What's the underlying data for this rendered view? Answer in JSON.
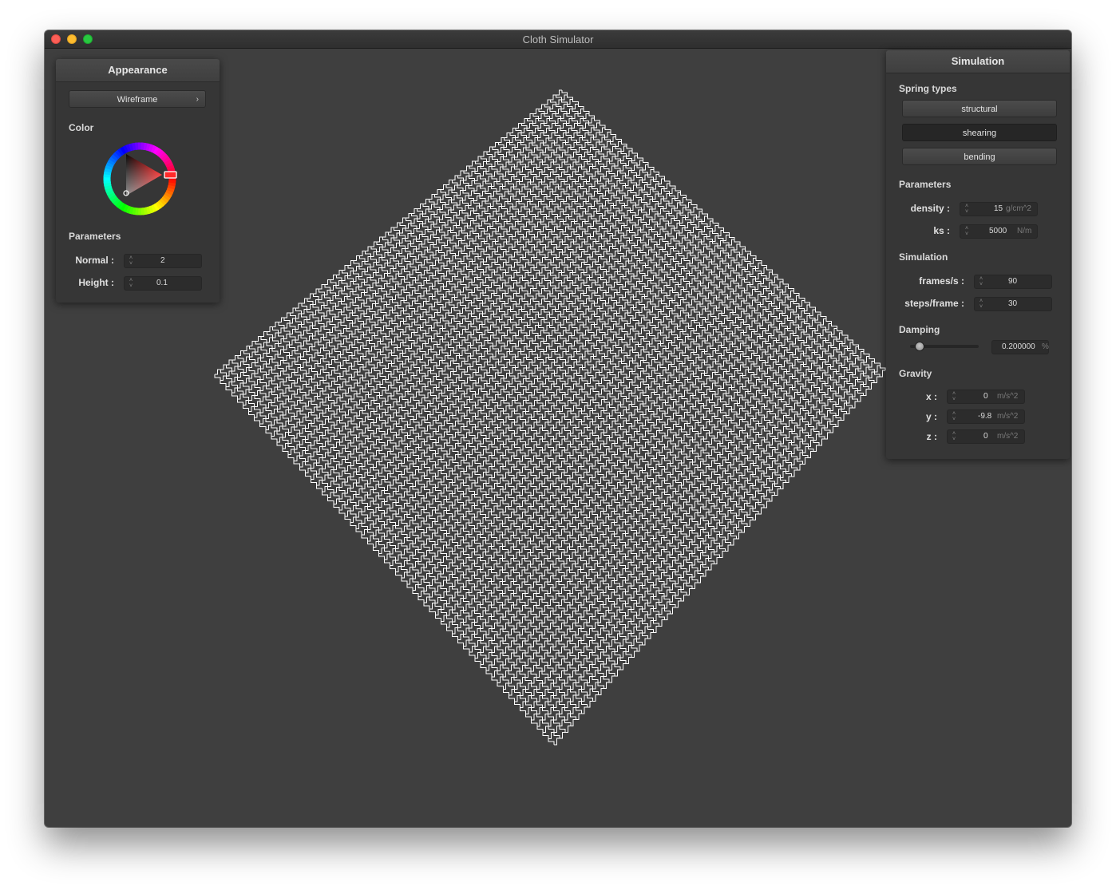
{
  "window": {
    "title": "Cloth Simulator"
  },
  "appearance": {
    "header": "Appearance",
    "shader_select": "Wireframe",
    "shader_chevron": "›",
    "color_label": "Color",
    "parameters_label": "Parameters",
    "normal_label": "Normal :",
    "normal_value": "2",
    "height_label": "Height :",
    "height_value": "0.1",
    "selected_color": "#ff0000"
  },
  "simulation": {
    "header": "Simulation",
    "spring_types_label": "Spring types",
    "spring_buttons": [
      "structural",
      "shearing",
      "bending"
    ],
    "parameters_label": "Parameters",
    "density_label": "density :",
    "density_value": "15",
    "density_unit": "g/cm^2",
    "ks_label": "ks :",
    "ks_value": "5000",
    "ks_unit": "N/m",
    "simulation_label": "Simulation",
    "fps_label": "frames/s :",
    "fps_value": "90",
    "steps_label": "steps/frame :",
    "steps_value": "30",
    "damping_label": "Damping",
    "damping_value": "0.200000",
    "damping_unit": "%",
    "damping_level": 0.2,
    "gravity_label": "Gravity",
    "gx_label": "x :",
    "gx_value": "0",
    "gy_label": "y :",
    "gy_value": "-9.8",
    "gz_label": "z :",
    "gz_value": "0",
    "gravity_unit": "m/s^2"
  },
  "colors": {
    "background": "#3f3f3f",
    "wireframe": "#ffffff",
    "panel": "#363636"
  }
}
